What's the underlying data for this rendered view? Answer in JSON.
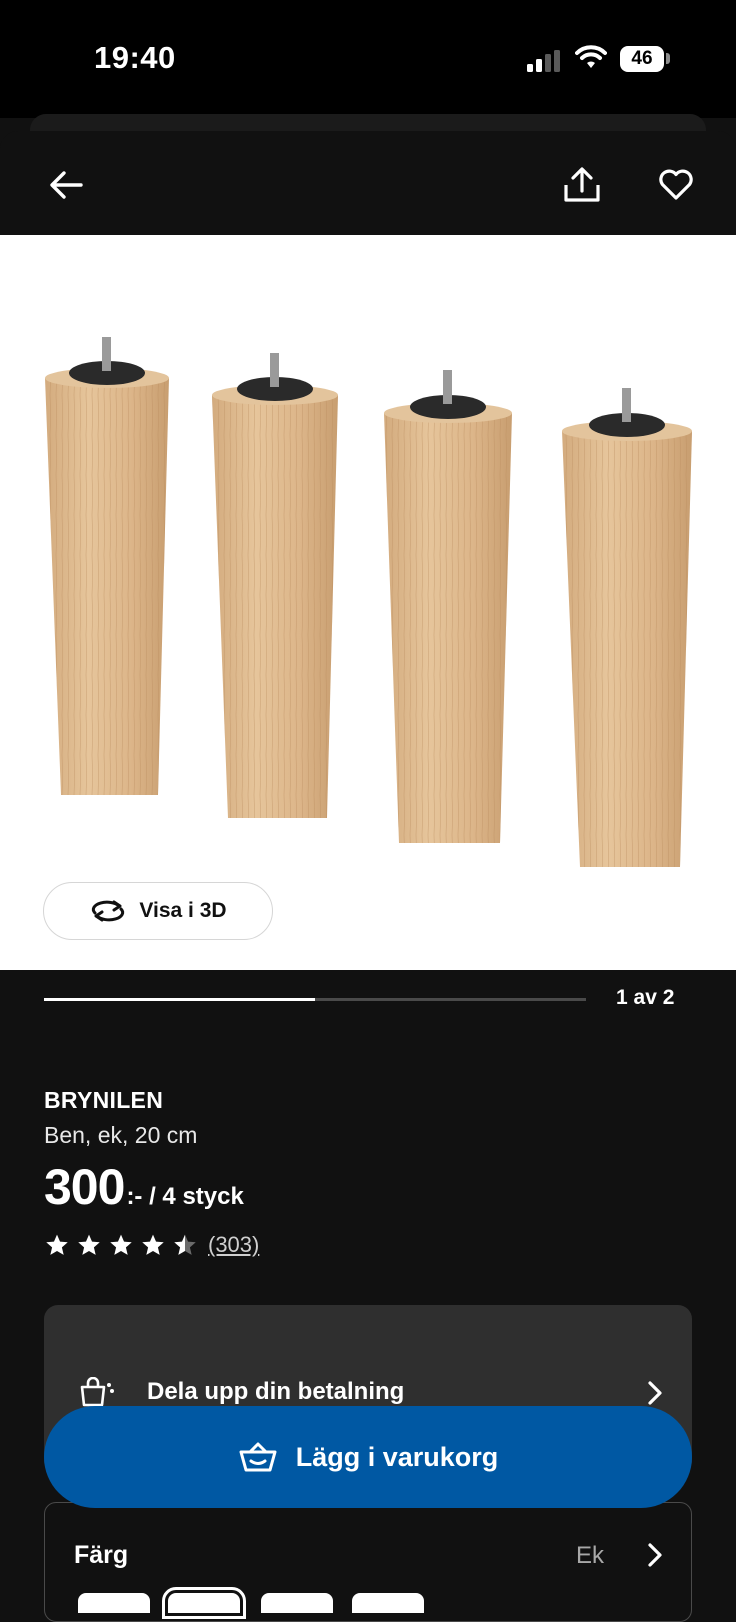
{
  "status_bar": {
    "time": "19:40",
    "battery": "46"
  },
  "header": {
    "back_icon": "arrow-left-icon",
    "share_icon": "share-icon",
    "favorite_icon": "heart-icon"
  },
  "gallery": {
    "view_3d_label": "Visa i 3D",
    "counter": "1 av 2",
    "progress_fraction": 0.5
  },
  "product": {
    "name": "BRYNILEN",
    "description": "Ben, ek, 20 cm",
    "price": "300",
    "price_suffix": ":- / 4 styck",
    "rating": 4.5,
    "reviews": "(303)"
  },
  "payment": {
    "label": "Dela upp din betalning"
  },
  "cart": {
    "label": "Lägg i varukorg"
  },
  "color": {
    "label": "Färg",
    "value": "Ek"
  },
  "colors": {
    "accent": "#0058a3",
    "background": "#111111",
    "card": "#2f2f2f"
  }
}
